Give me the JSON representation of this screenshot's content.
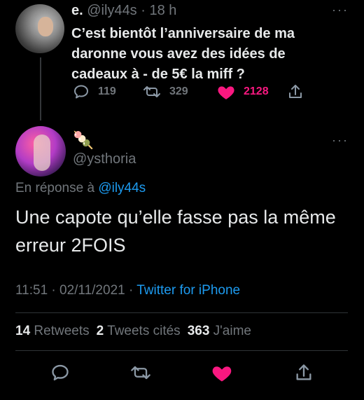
{
  "parent_tweet": {
    "display_name": "e.",
    "handle": "@ily44s",
    "time": "· 18 h",
    "text": "C’est bientôt l’anniversaire de ma daronne vous avez des idées de cadeaux à - de 5€ la miff ?",
    "replies": "119",
    "retweets": "329",
    "likes": "2128"
  },
  "reply_tweet": {
    "name_emoji": "🍡",
    "handle": "@ysthoria",
    "in_reply_prefix": "En réponse à",
    "in_reply_handle": "@ily44s",
    "text": "Une capote qu’elle fasse pas la même erreur 2FOIS",
    "timestamp": "11:51 · 02/11/2021 ·",
    "client": "Twitter for iPhone",
    "retweets_count": "14",
    "retweets_label": "Retweets",
    "quotes_count": "2",
    "quotes_label": "Tweets cités",
    "likes_count": "363",
    "likes_label": "J'aime"
  },
  "colors": {
    "background": "#000000",
    "text": "#e7e9ea",
    "muted": "#71767b",
    "link": "#1d9bf0",
    "like": "#f91880"
  },
  "icons": {
    "reply": "speech-bubble-icon",
    "retweet": "retweet-arrows-icon",
    "like": "heart-icon",
    "share": "share-upload-icon",
    "more": "more-dots-icon"
  }
}
